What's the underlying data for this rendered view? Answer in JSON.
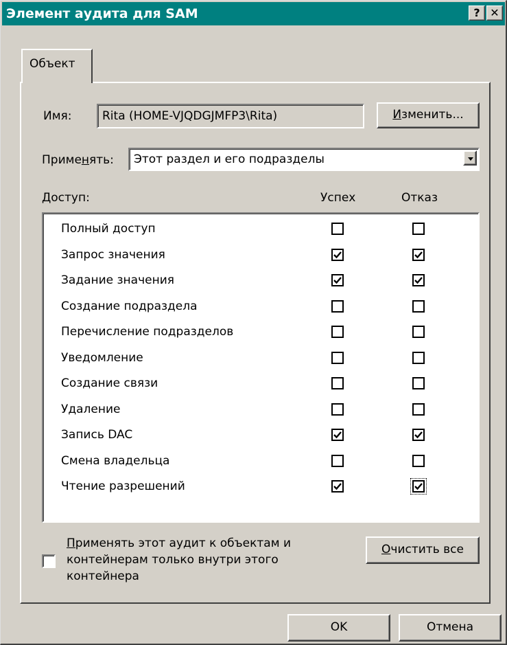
{
  "window": {
    "title": "Элемент аудита для SAM",
    "help_label": "?",
    "close_label": "✕"
  },
  "tab": {
    "label": "Объект"
  },
  "name_row": {
    "label": "Имя:",
    "value": "Rita (HOME-VJQDGJMFP3\\Rita)",
    "change_button_prefix": "И",
    "change_button_rest": "зменить..."
  },
  "apply_row": {
    "label_pre": "Приме",
    "label_u": "н",
    "label_post": "ять:",
    "selected": "Этот раздел и его подразделы"
  },
  "access_header": {
    "label_u": "Д",
    "label_rest": "оступ:",
    "success": "Успех",
    "failure": "Отказ"
  },
  "permissions": [
    {
      "name": "Полный доступ",
      "success": false,
      "failure": false
    },
    {
      "name": "Запрос значения",
      "success": true,
      "failure": true
    },
    {
      "name": "Задание значения",
      "success": true,
      "failure": true
    },
    {
      "name": "Создание подраздела",
      "success": false,
      "failure": false
    },
    {
      "name": "Перечисление подразделов",
      "success": false,
      "failure": false
    },
    {
      "name": "Уведомление",
      "success": false,
      "failure": false
    },
    {
      "name": "Создание связи",
      "success": false,
      "failure": false
    },
    {
      "name": "Удаление",
      "success": false,
      "failure": false
    },
    {
      "name": "Запись DAC",
      "success": true,
      "failure": true
    },
    {
      "name": "Смена владельца",
      "success": false,
      "failure": false
    },
    {
      "name": "Чтение разрешений",
      "success": true,
      "failure": true
    }
  ],
  "apply_only_container": {
    "checked": false,
    "line1_u": "П",
    "line1_rest": "рименять этот аудит к объектам и",
    "line2": "контейнерам только внутри этого",
    "line3": "контейнера"
  },
  "clear_button": {
    "label_u": "О",
    "label_rest": "чистить все"
  },
  "footer": {
    "ok_label": "OK",
    "cancel_label": "Отмена"
  },
  "colors": {
    "titlebar": "#008080",
    "face": "#d4d0c8"
  }
}
